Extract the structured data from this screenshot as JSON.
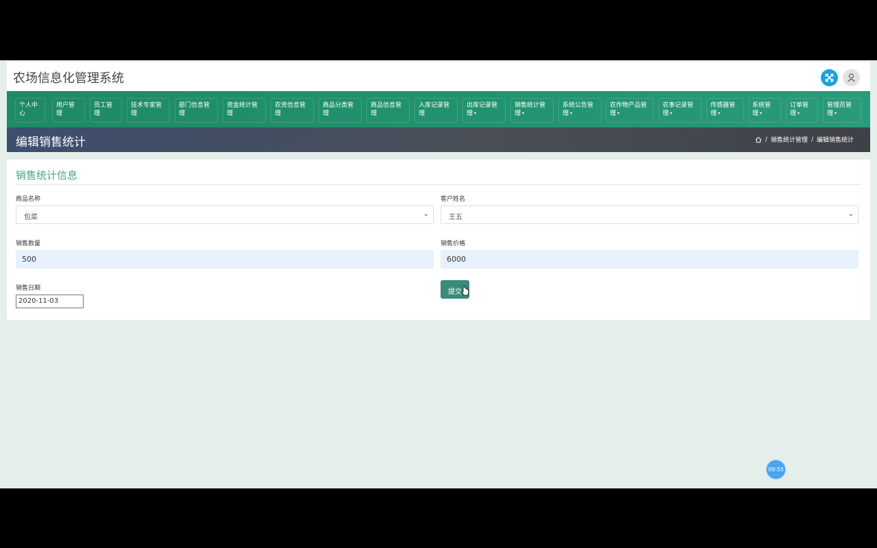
{
  "app": {
    "title": "农场信息化管理系统"
  },
  "topbar": {
    "expand_icon": "expand-icon",
    "user_icon": "user-icon",
    "expand_color": "#1aa3dc"
  },
  "nav": {
    "items": [
      {
        "line1": "个人中",
        "line2": "心",
        "caret": false
      },
      {
        "line1": "用户管",
        "line2": "理",
        "caret": false
      },
      {
        "line1": "员工管",
        "line2": "理",
        "caret": false
      },
      {
        "line1": "技术专家管",
        "line2": "理",
        "caret": false
      },
      {
        "line1": "部门信息管",
        "line2": "理",
        "caret": false
      },
      {
        "line1": "资金统计管",
        "line2": "理",
        "caret": false
      },
      {
        "line1": "农资信息管",
        "line2": "理",
        "caret": false
      },
      {
        "line1": "商品分类管",
        "line2": "理",
        "caret": false
      },
      {
        "line1": "商品信息管",
        "line2": "理",
        "caret": false
      },
      {
        "line1": "入库记录管",
        "line2": "理",
        "caret": false
      },
      {
        "line1": "出库记录管",
        "line2": "理",
        "caret": true
      },
      {
        "line1": "销售统计管",
        "line2": "理",
        "caret": true
      },
      {
        "line1": "系统公告管",
        "line2": "理",
        "caret": true
      },
      {
        "line1": "农作物产品管",
        "line2": "理",
        "caret": true
      },
      {
        "line1": "农事记录管",
        "line2": "理",
        "caret": true
      },
      {
        "line1": "传感器管",
        "line2": "理",
        "caret": true
      },
      {
        "line1": "系统管",
        "line2": "理",
        "caret": true
      },
      {
        "line1": "订单管",
        "line2": "理",
        "caret": true
      },
      {
        "line1": "管理员管",
        "line2": "理",
        "caret": true
      }
    ]
  },
  "header": {
    "page_title": "编辑销售统计",
    "breadcrumb": {
      "home_icon": "home-icon",
      "sep": "/",
      "parent": "销售统计管理",
      "current": "编辑销售统计"
    }
  },
  "form": {
    "title": "销售统计信息",
    "product_label": "商品名称",
    "product_value": "包菜",
    "customer_label": "客户姓名",
    "customer_value": "王五",
    "quantity_label": "销售数量",
    "quantity_value": "500",
    "price_label": "销售价格",
    "price_value": "6000",
    "date_label": "销售日期",
    "date_value": "2020-11-03",
    "submit_label": "提交"
  },
  "clock": {
    "time": "09:55"
  }
}
